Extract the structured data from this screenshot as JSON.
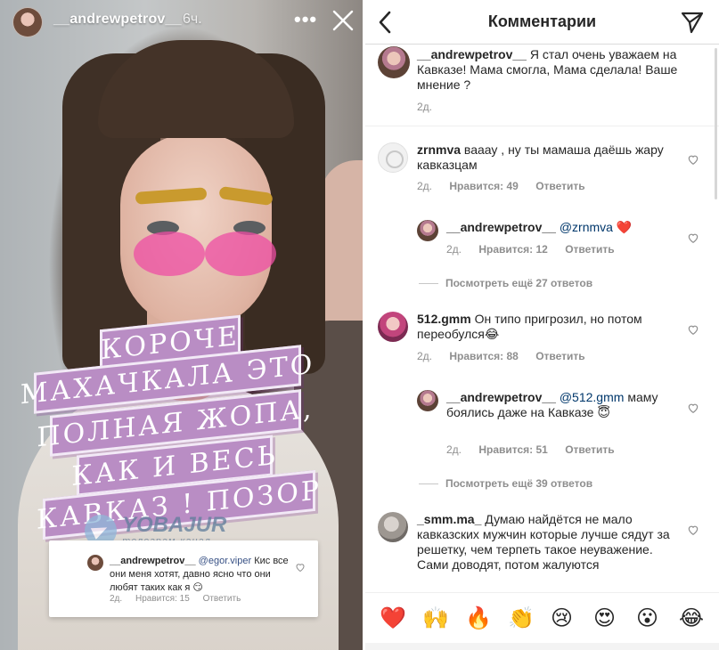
{
  "story": {
    "username": "__andrewpetrov__",
    "time": "6ч.",
    "more_icon": "more-dots-icon",
    "close_icon": "close-icon",
    "caption_lines": [
      "КОРОЧЕ",
      "МАХАЧКАЛА ЭТО",
      "ПОЛНАЯ ЖОПА,",
      "КАК И ВЕСЬ",
      "КАВКАЗ ! ПОЗОР"
    ],
    "watermark": {
      "title": "YOBAJUR",
      "subtitle": "телеграм-канал"
    },
    "comment_card": {
      "username": "__andrewpetrov__",
      "mention": "@egor.viper",
      "text": "Кис все они меня хотят, давно ясно что они любят таких как я 😏",
      "age": "2д.",
      "likes": "Нравится: 15",
      "reply": "Ответить"
    }
  },
  "comments_screen": {
    "title": "Комментарии",
    "back_icon": "back-chevron-icon",
    "send_icon": "send-icon",
    "caption": {
      "username": "__andrewpetrov__",
      "text": "Я стал очень уважаем на Кавказе! Мама смогла, Мама сделала! Ваше мнение ?",
      "age": "2д."
    },
    "comments": [
      {
        "username": "zrnmva",
        "text": "вааау , ну ты мамаша даёшь жару кавказцам",
        "age": "2д.",
        "likes": "Нравится: 49",
        "reply": "Ответить",
        "replies": [
          {
            "username": "__andrewpetrov__",
            "mention": "@zrnmva",
            "text": "❤️",
            "age": "2д.",
            "likes": "Нравится: 12",
            "reply": "Ответить"
          }
        ],
        "view_more": "Посмотреть ещё 27 ответов"
      },
      {
        "username": "512.gmm",
        "text": "Он типо пригрозил, но потом переобулся😂",
        "age": "2д.",
        "likes": "Нравится: 88",
        "reply": "Ответить",
        "replies": [
          {
            "username": "__andrewpetrov__",
            "mention": "@512.gmm",
            "text": "маму боялись даже на Кавказе 😇",
            "age": "2д.",
            "likes": "Нравится: 51",
            "reply": "Ответить"
          }
        ],
        "view_more": "Посмотреть ещё 39 ответов"
      },
      {
        "username": "_smm.ma_",
        "text": "Думаю найдётся не мало кавказских мужчин которые лучше сядут за решетку, чем терпеть такое неуважение. Сами доводят, потом жалуются"
      }
    ],
    "emoji_bar": [
      "❤️",
      "🙌",
      "🔥",
      "👏",
      "😢",
      "😍",
      "😮",
      "😂"
    ],
    "colors": {
      "mention": "#00376b",
      "meta": "#8e8e8e",
      "caption_bg": "#b98dc4",
      "heart": "#ed4956"
    }
  }
}
